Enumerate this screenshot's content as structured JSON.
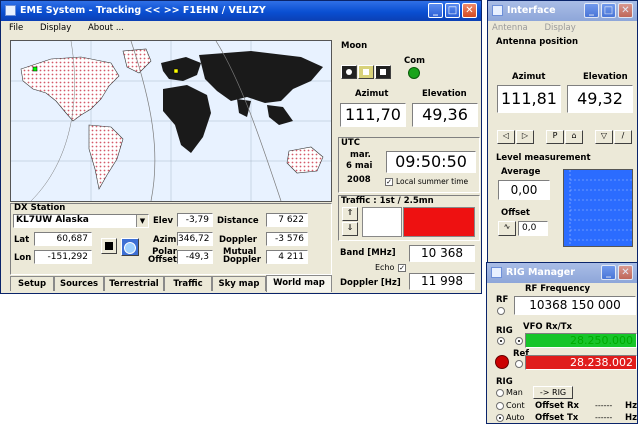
{
  "main_window": {
    "title": "EME System - Tracking << >> F1EHN / VELIZY",
    "menu": [
      "File",
      "Display",
      "About ..."
    ],
    "moon": {
      "label": "Moon",
      "com_label": "Com",
      "azimut_label": "Azimut",
      "elevation_label": "Elevation",
      "azimut": "111,70",
      "elevation": "49,36"
    },
    "utc": {
      "label": "UTC",
      "day": "mar.",
      "date": "6 mai",
      "year": "2008",
      "time": "09:50:50",
      "local_summer_time_label": "Local summer time",
      "local_summer_time_checked": true
    },
    "traffic": {
      "label": "Traffic : 1st / 2.5mn"
    },
    "band_label": "Band [MHz]",
    "band": "10 368",
    "echo_label": "Echo",
    "doppler_hz_label": "Doppler [Hz]",
    "doppler_hz": "11 998",
    "dx_station": {
      "label": "DX Station",
      "name": "KL7UW Alaska",
      "lat_label": "Lat",
      "lat": "60,687",
      "lon_label": "Lon",
      "lon": "-151,292",
      "elev_label": "Elev",
      "elev": "-3,79",
      "azim_label": "Azim",
      "azim": "346,72",
      "polar_offset_label": "Polar Offset",
      "polar_offset": "-49,3",
      "distance_label": "Distance",
      "distance": "7 622",
      "doppler_label": "Doppler",
      "doppler": "-3 576",
      "mutual_doppler_label": "Mutual Doppler",
      "mutual_doppler": "4 211"
    },
    "tabs": [
      "Setup",
      "Sources",
      "Terrestrial",
      "Traffic",
      "Sky map",
      "World map"
    ],
    "active_tab": "World map"
  },
  "interface_window": {
    "title": "Interface",
    "menu": [
      "Antenna",
      "Display"
    ],
    "antenna_position_label": "Antenna position",
    "azimut_label": "Azimut",
    "elevation_label": "Elevation",
    "azimut": "111,81",
    "elevation": "49,32",
    "level_measurement_label": "Level measurement",
    "average_label": "Average",
    "average": "0,00",
    "offset_label": "Offset",
    "offset": "0,0"
  },
  "rig_window": {
    "title": "RIG Manager",
    "rf_label": "RF",
    "rf_frequency_label": "RF Frequency",
    "rf_frequency": "10368 150 000",
    "rig_label": "RIG",
    "vfo_label": "VFO Rx/Tx",
    "vfo_value": "28.250.000",
    "ref_label": "Ref",
    "ref_value": "28.238.002",
    "rig_mode_label": "RIG",
    "man_label": "Man",
    "cont_label": "Cont",
    "auto_label": "Auto",
    "to_rig_label": "-> RIG",
    "offset_rx_label": "Offset Rx",
    "offset_tx_label": "Offset Tx",
    "offset_rx": "------",
    "offset_tx": "------",
    "hz_unit": "Hz"
  },
  "colors": {
    "title_blue": "#0a4fd2",
    "ocean": "#e8f2ff",
    "land_dark": "#1a1a1a",
    "land_dotted": "#d45a6a",
    "traffic_red": "#ee1111",
    "vfo_green": "#17c52a",
    "ref_red": "#e01c1c",
    "com_led": "#1aa31a",
    "rig_led": "#cc0000",
    "level_blue": "#2b6cff"
  },
  "icons": [
    "app-icon",
    "minimize-icon",
    "maximize-icon",
    "close-icon",
    "stop-icon",
    "world-icon"
  ]
}
